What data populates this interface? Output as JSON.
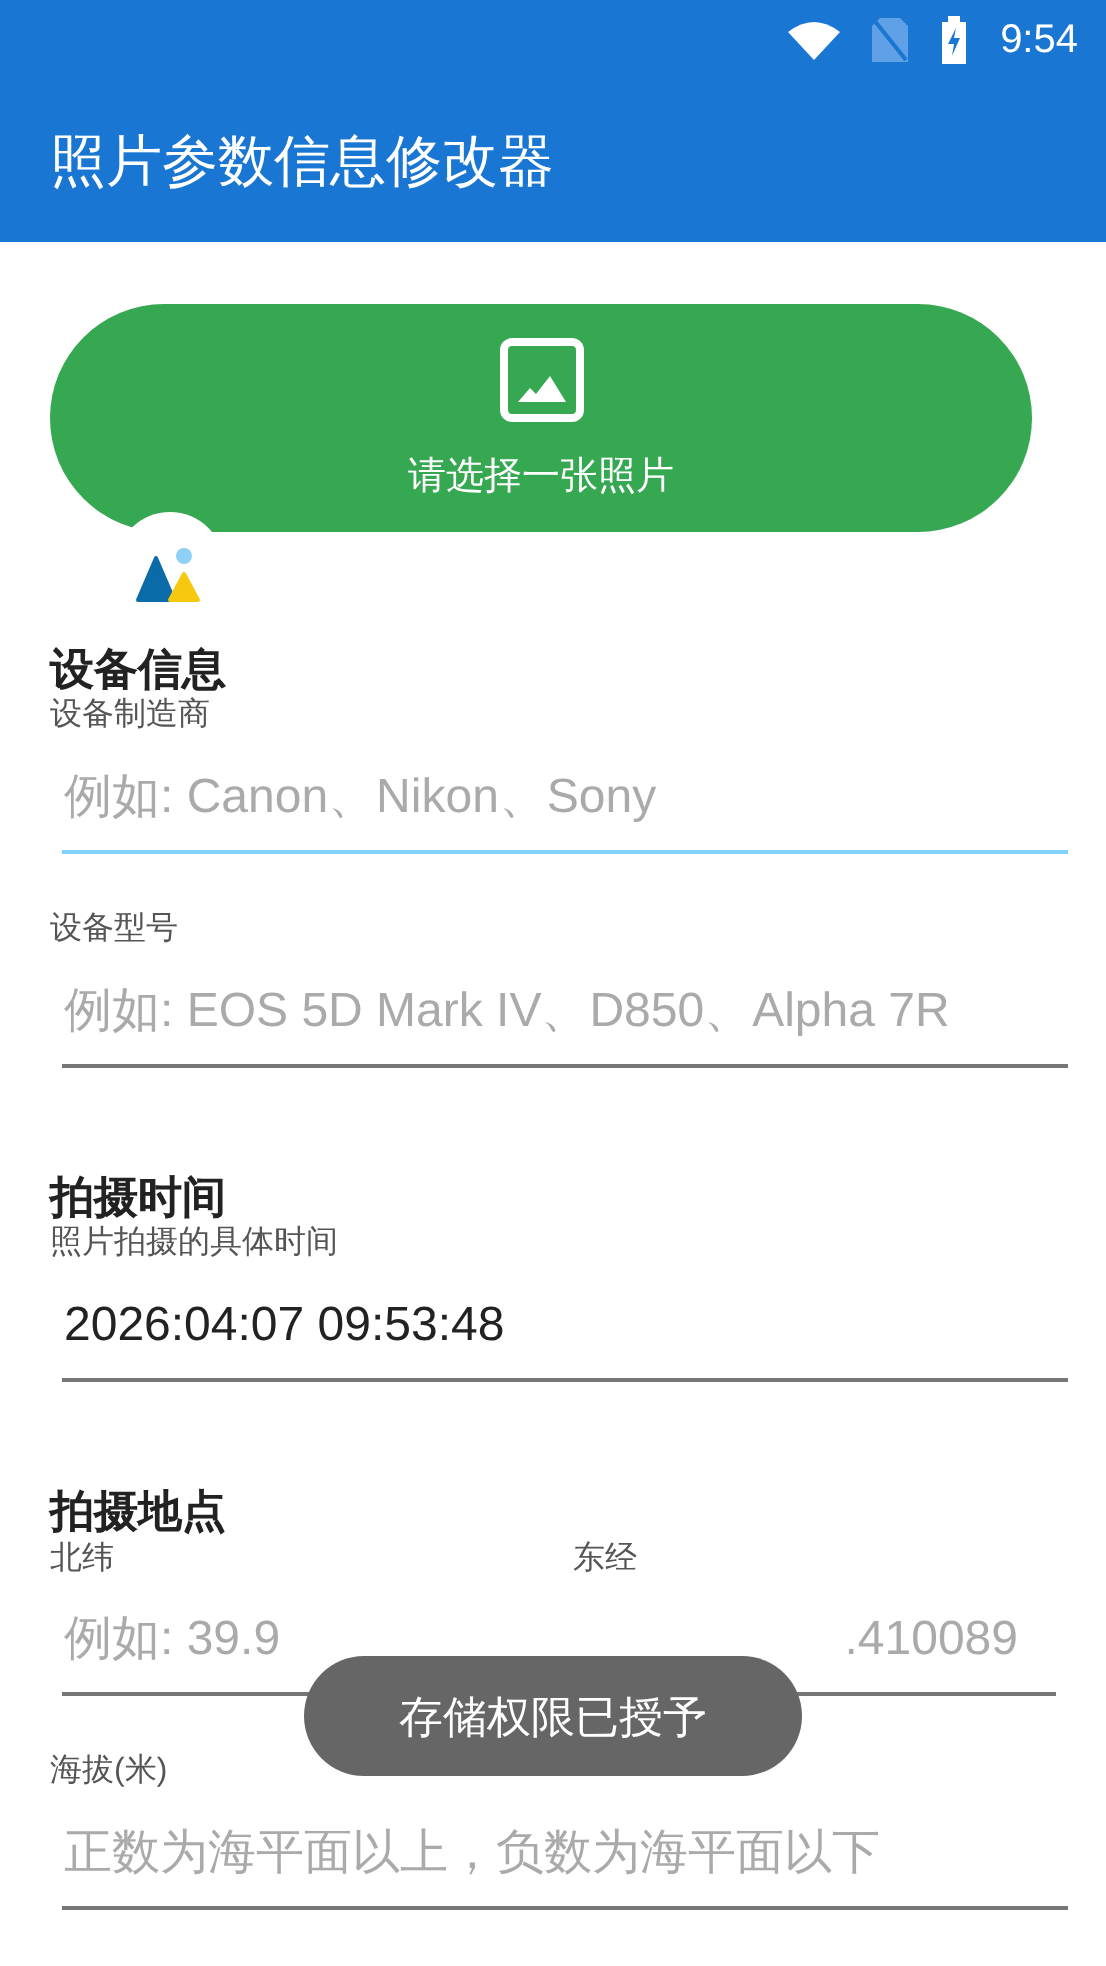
{
  "status_bar": {
    "time": "9:54"
  },
  "app_bar": {
    "title": "照片参数信息修改器"
  },
  "pick_button": {
    "label": "请选择一张照片"
  },
  "sections": [
    {
      "title": "设备信息",
      "fields": [
        {
          "label": "设备制造商",
          "placeholder": "例如: Canon、Nikon、Sony",
          "focused": true
        },
        {
          "label": "设备型号",
          "placeholder": "例如: EOS 5D Mark IV、D850、Alpha 7R",
          "focused": false
        }
      ]
    },
    {
      "title": "拍摄时间",
      "fields": [
        {
          "label": "照片拍摄的具体时间",
          "value": "2026:04:07 09:53:48",
          "focused": false
        }
      ]
    },
    {
      "title": "拍摄地点",
      "pairs": [
        [
          {
            "label": "北纬",
            "placeholder": "例如: 39.9",
            "focused": false
          },
          {
            "label": "东经",
            "placeholder": ".410089",
            "focused": false
          }
        ]
      ],
      "fields": [
        {
          "label": "海拔(米)",
          "placeholder": "正数为海平面以上，负数为海平面以下",
          "focused": false
        }
      ]
    }
  ],
  "toast": {
    "text": "存储权限已授予"
  }
}
